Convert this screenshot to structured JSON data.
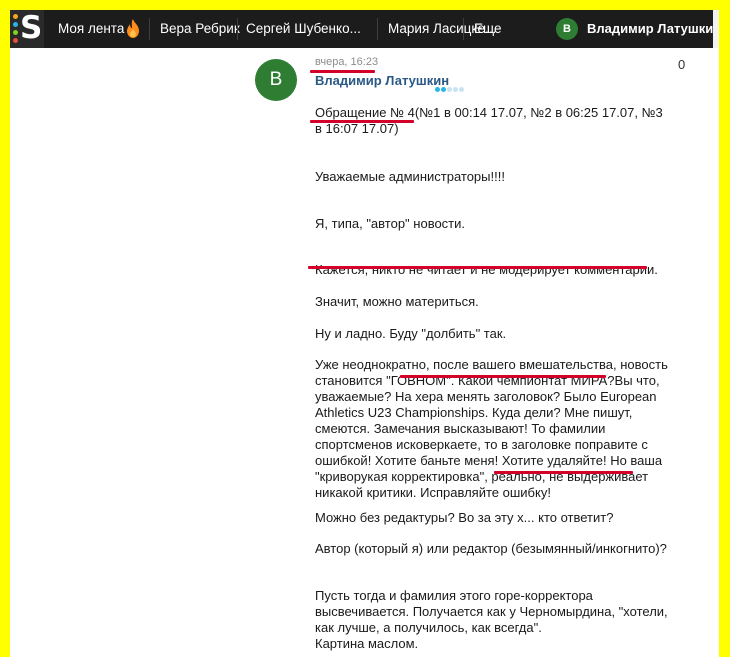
{
  "nav": {
    "logo_letter": "S",
    "logo_dot_colors": [
      "#f5a623",
      "#2bb5e3",
      "#7ed321",
      "#e84c3d"
    ],
    "items": [
      "Моя лента",
      "Вера Ребрик",
      "Сергей Шубенко...",
      "Мария Ласицке...",
      "Еще"
    ],
    "feed_icon": "fire-icon",
    "user_avatar_letter": "В",
    "user_name": "Владимир Латушки..."
  },
  "comment": {
    "avatar_letter": "В",
    "timestamp": "вчера, 16:23",
    "likes": "0",
    "author": "Владимир Латушкин",
    "rating_dot_colors": [
      "#2bb5e3",
      "#2bb5e3",
      "#c8e4f1",
      "#c8e4f1",
      "#c8e4f1"
    ],
    "paragraphs": [
      "Обращение № 4(№1 в 00:14 17.07, №2 в 06:25 17.07, №3 в 16:07 17.07)",
      "Уважаемые администраторы!!!!",
      "Я, типа, \"автор\" новости.",
      "Кажется, никто не читает и не модерирует комментарии.",
      "Значит, можно материться.",
      "Ну и ладно. Буду \"долбить\" так.",
      "Уже неоднократно, после вашего вмешательства, новость становится \"ГОВНОМ\". Какой чемпионтат МИРА?Вы что, уважаемые? На хера менять заголовок? Было European Athletics U23 Championships. Куда дели? Мне пишут, смеются. Замечания высказывают! То фамилии спортсменов исковеркаете, то в заголовке поправите с ошибкой! Хотите баньте меня! Хотите удаляйте! Но ваша \"криворукая корректировка\", реально, не выдерживает никакой критики. Исправляйте ошибку!",
      "Можно без редактуры? Во за эту х... кто ответит?",
      "Автор (который я) или редактор (безымянный/инкогнито)?",
      "Пусть тогда и фамилия этого горе-корректора высвечивается. Получается как у Черномырдина, \"хотели, как лучше, а получилось, как всегда\".",
      "Картина маслом."
    ]
  },
  "colors": {
    "frame": "#ffff00",
    "navbar": "#1c1c1c",
    "annotation": "#d4002a",
    "author": "#2a5885",
    "avatar": "#2e7d32"
  }
}
